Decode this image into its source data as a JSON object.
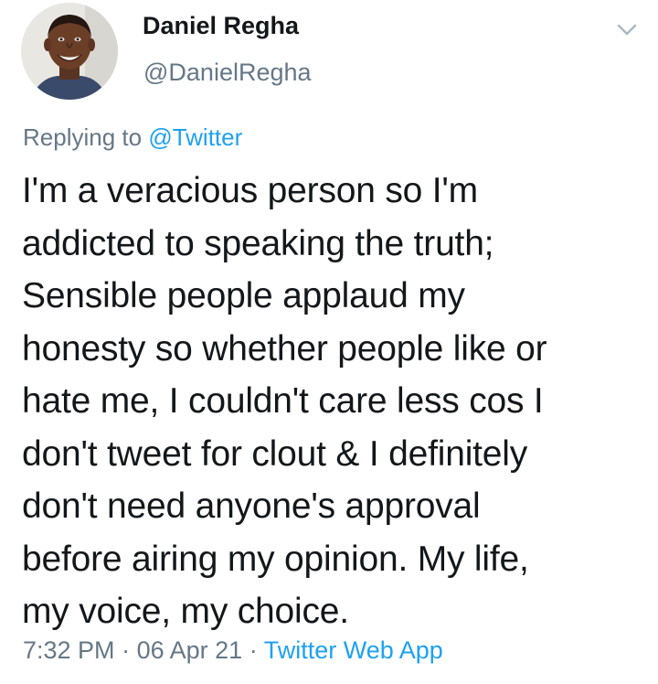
{
  "user": {
    "display_name": "Daniel Regha",
    "handle": "@DanielRegha",
    "avatar_icon": "profile-photo"
  },
  "reply": {
    "prefix": "Replying to",
    "mention": "@Twitter"
  },
  "tweet": {
    "lines": [
      "I'm a veracious person so I'm",
      "addicted to speaking the truth;",
      "Sensible people applaud my",
      "honesty so whether people like or",
      "hate me, I couldn't care less cos I",
      "don't tweet for clout & I definitely",
      "don't need anyone's approval",
      "before airing my opinion. My life,",
      "my voice, my choice."
    ]
  },
  "meta": {
    "time": "7:32 PM",
    "separator": "·",
    "date": "06 Apr 21",
    "source": "Twitter Web App"
  },
  "icons": {
    "menu": "chevron-down-icon"
  },
  "colors": {
    "text": "#14171a",
    "secondary": "#657786",
    "link": "#1da1f2",
    "caret": "#aab8c2"
  }
}
